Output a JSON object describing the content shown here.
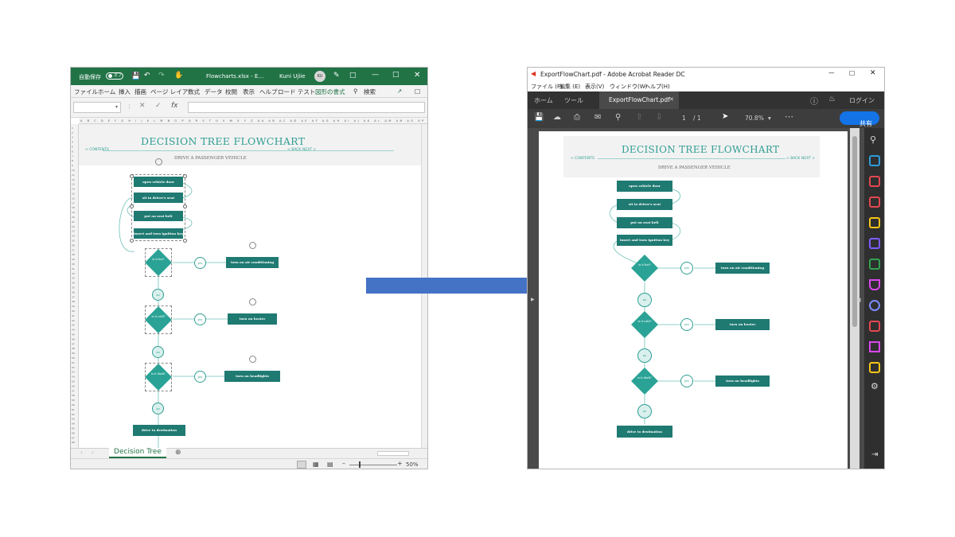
{
  "excel": {
    "autosave_label": "自動保存",
    "autosave_state": "オフ",
    "filename": "Flowcharts.xlsx - E…",
    "user_name": "Kuni Ujiie",
    "user_initials": "KU",
    "menu": [
      "ファイル",
      "ホーム",
      "挿入",
      "描画",
      "ページ レイア",
      "数式",
      "データ",
      "校閲",
      "表示",
      "ヘルプ",
      "ロード テスト",
      "図形の書式",
      "検索"
    ],
    "namebox_value": "",
    "column_letters": "A B C D E F G H I J K L M N O P Q R S T U V W X Y Z AA AB AC AD AE AF AG AH AI AJ AK AL AM AN AO AP AQ AR AS AT AU AV AW AX AY AZ BA",
    "sheet_tab": "Decision Tree",
    "zoom": "50%"
  },
  "flowchart": {
    "title": "DECISION TREE FLOWCHART",
    "subtitle": "DRIVE A PASSENGER VEHICLE",
    "contents_link": "< CONTENTS",
    "back_link": "< BACK",
    "next_link": "NEXT >",
    "steps": [
      "open vehicle door",
      "sit in driver's seat",
      "put on seat belt",
      "insert and turn ignition key"
    ],
    "decisions": [
      "is it hot?",
      "is it cold?",
      "is it dark?"
    ],
    "actions": [
      "turn on air conditioning",
      "turn on heater",
      "turn on headlights"
    ],
    "yes_label": "yes",
    "no_label": "no",
    "final": "drive to destination"
  },
  "acrobat": {
    "window_title": "ExportFlowChart.pdf - Adobe Acrobat Reader DC",
    "menu": [
      "ファイル (F)",
      "編集 (E)",
      "表示(V)",
      "ウィンドウ(W)",
      "ヘルプ(H)"
    ],
    "home_tab": "ホーム",
    "tools_tab": "ツール",
    "doc_tab": "ExportFlowChart.pdf",
    "login_label": "ログイン",
    "page_current": "1",
    "page_total": "/ 1",
    "zoom": "70.8%",
    "share_label": "共有"
  },
  "colors": {
    "excel_green": "#217346",
    "flow_dark": "#1f7a72",
    "flow_diamond": "#2aa396",
    "arrow_blue": "#4472c4",
    "acrobat_blue": "#1473e6"
  }
}
